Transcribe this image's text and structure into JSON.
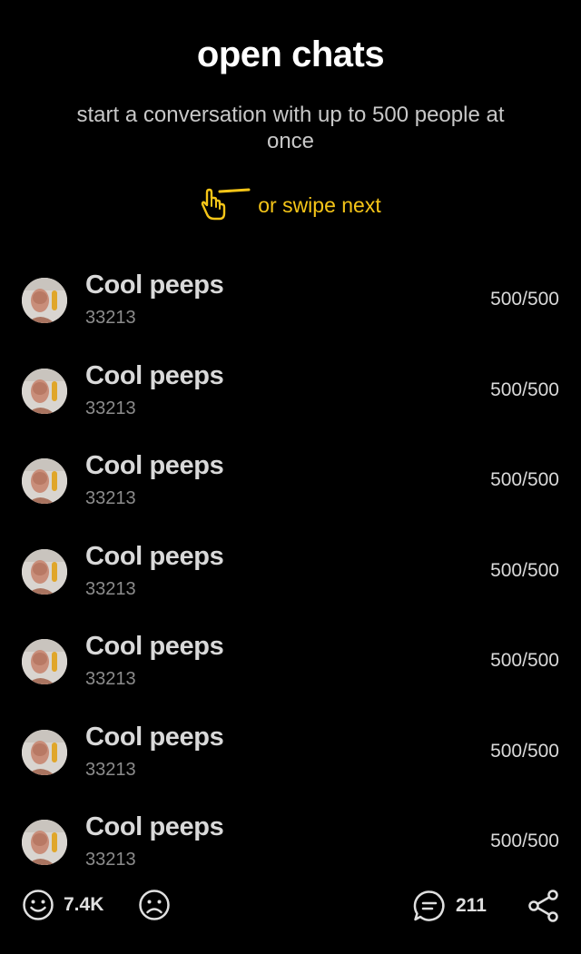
{
  "header": {
    "title": "open chats",
    "subtitle": "start a conversation with up to 500 people at once",
    "hint_text": "or swipe next"
  },
  "chats": [
    {
      "name": "Cool peeps",
      "id": "33213",
      "count": "500/500"
    },
    {
      "name": "Cool peeps",
      "id": "33213",
      "count": "500/500"
    },
    {
      "name": "Cool peeps",
      "id": "33213",
      "count": "500/500"
    },
    {
      "name": "Cool peeps",
      "id": "33213",
      "count": "500/500"
    },
    {
      "name": "Cool peeps",
      "id": "33213",
      "count": "500/500"
    },
    {
      "name": "Cool peeps",
      "id": "33213",
      "count": "500/500"
    },
    {
      "name": "Cool peeps",
      "id": "33213",
      "count": "500/500"
    }
  ],
  "bottom_bar": {
    "likes": "7.4K",
    "comments": "211",
    "icons": [
      "smile-icon",
      "sad-face-icon",
      "comment-icon",
      "share-icon"
    ]
  },
  "colors": {
    "background": "#000000",
    "accent": "#f5c518",
    "primary_text": "#ffffff",
    "secondary_text": "#8c8c8c"
  }
}
